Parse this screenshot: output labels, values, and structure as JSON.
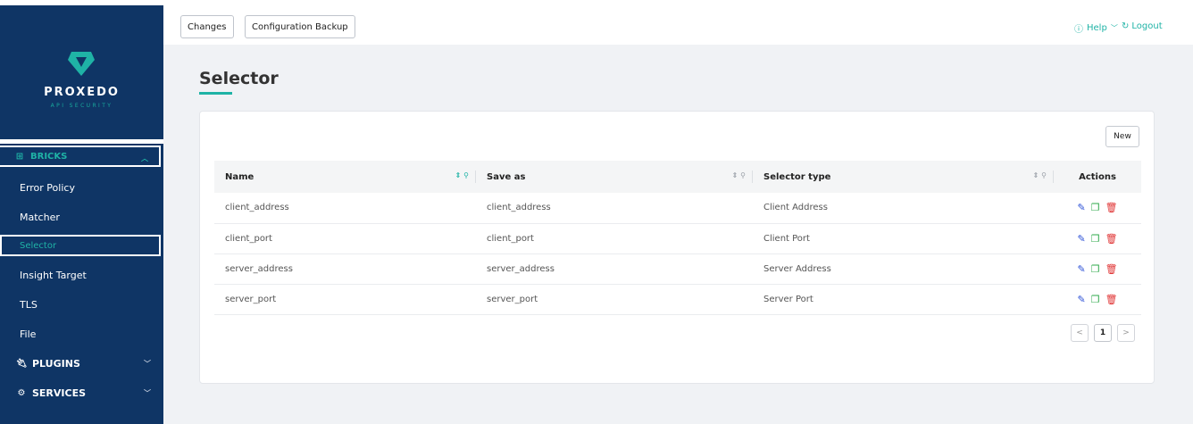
{
  "brand": {
    "name": "PROXEDO",
    "tagline": "API SECURITY",
    "accent": "#1fb3a6",
    "navy": "#0f3565"
  },
  "sidebar": {
    "bricks": {
      "label": "BRICKS",
      "icon": "grid-icon"
    },
    "items": [
      {
        "label": "Error Policy"
      },
      {
        "label": "Matcher"
      },
      {
        "label": "Selector"
      },
      {
        "label": "Insight Target"
      },
      {
        "label": "TLS"
      },
      {
        "label": "File"
      }
    ],
    "plugins": {
      "label": "PLUGINS",
      "icon": "plug-icon"
    },
    "services": {
      "label": "SERVICES",
      "icon": "gear-icon"
    }
  },
  "topbar": {
    "changes_label": "Changes",
    "backup_label": "Configuration Backup",
    "help_label": "Help",
    "logout_label": "Logout"
  },
  "page": {
    "title": "Selector"
  },
  "card": {
    "new_label": "New"
  },
  "table": {
    "columns": [
      {
        "label": "Name"
      },
      {
        "label": "Save as"
      },
      {
        "label": "Selector type"
      },
      {
        "label": "Actions"
      }
    ],
    "rows": [
      {
        "name": "client_address",
        "save_as": "client_address",
        "type": "Client Address"
      },
      {
        "name": "client_port",
        "save_as": "client_port",
        "type": "Client Port"
      },
      {
        "name": "server_address",
        "save_as": "server_address",
        "type": "Server Address"
      },
      {
        "name": "server_port",
        "save_as": "server_port",
        "type": "Server Port"
      }
    ]
  },
  "pagination": {
    "prev": "<",
    "current": "1",
    "next": ">"
  }
}
